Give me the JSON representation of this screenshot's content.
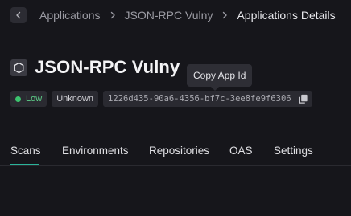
{
  "breadcrumb": {
    "items": [
      "Applications",
      "JSON-RPC Vulny"
    ],
    "current": "Applications Details"
  },
  "title": "JSON-RPC Vulny",
  "tooltip": "Copy App Id",
  "badges": {
    "severity": "Low",
    "status": "Unknown",
    "app_id": "1226d435-90a6-4356-bf7c-3ee8fe9f6306"
  },
  "tabs": [
    "Scans",
    "Environments",
    "Repositories",
    "OAS",
    "Settings"
  ],
  "active_tab": "Scans",
  "colors": {
    "background": "#16161b",
    "accent": "#2bb39a",
    "severity_low": "#3cc36e"
  },
  "icons": {
    "back": "chevron-left-icon",
    "separator": "chevron-right-icon",
    "app": "hexagon-icon",
    "copy": "copy-icon"
  }
}
